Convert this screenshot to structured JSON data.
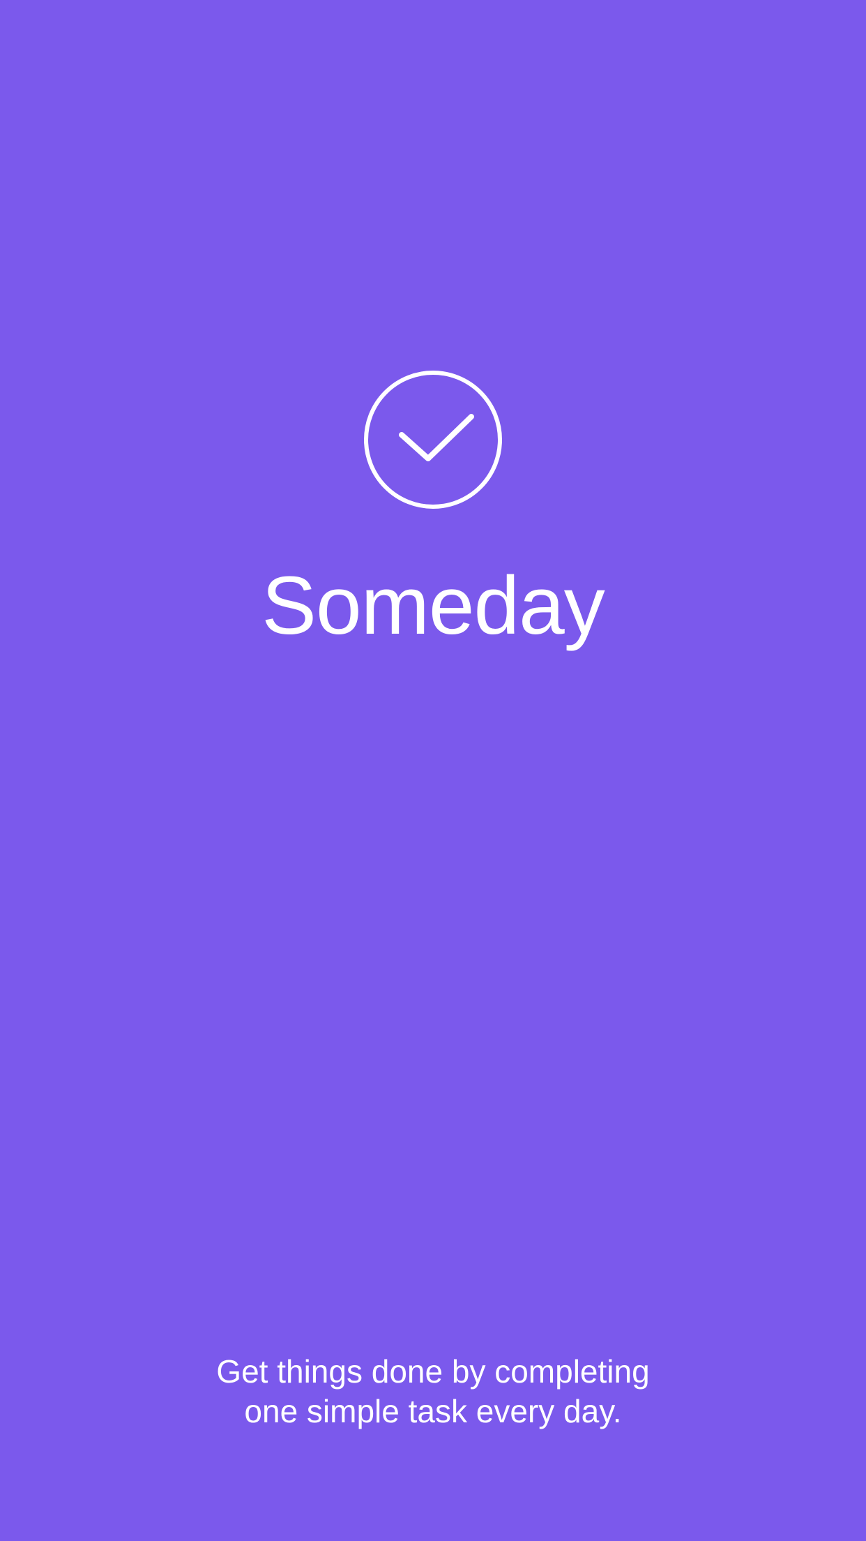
{
  "app": {
    "title": "Someday",
    "tagline_lines": [
      "Get things done by completing",
      "one simple task every day."
    ]
  },
  "icons": {
    "logo": "checkmark-circle-icon"
  },
  "colors": {
    "background": "#7B59EC",
    "foreground": "#FFFFFF"
  }
}
